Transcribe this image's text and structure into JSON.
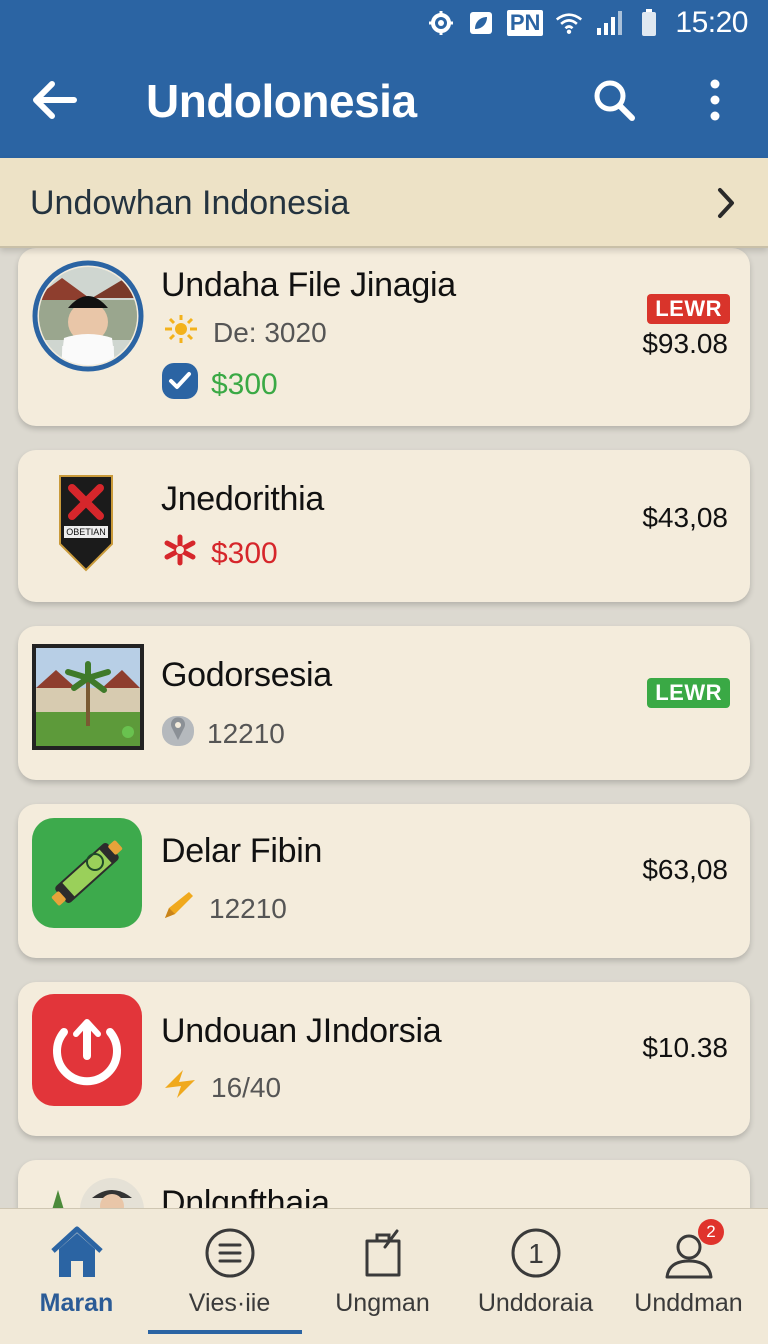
{
  "status_bar": {
    "time": "15:20",
    "carrier": "PN"
  },
  "app_bar": {
    "title": "Undolonesia"
  },
  "category": {
    "label": "Undowhan Indonesia"
  },
  "items": [
    {
      "name": "Undaha File Jinagia",
      "meta_icon": "sun-icon",
      "meta_text": "De: 3020",
      "sub_icon": "check-badge-icon",
      "sub_text": "$300",
      "badge": "LEWR",
      "price": "$93.08"
    },
    {
      "name": "Jnedorithia",
      "logo_text": "OBETIAN",
      "meta_icon": "flower-icon",
      "meta_text": "$300",
      "price": "$43,08"
    },
    {
      "name": "Godorsesia",
      "meta_icon": "pin-icon",
      "meta_text": "12210",
      "badge": "LEWR"
    },
    {
      "name": "Delar Fibin",
      "meta_icon": "pencil-icon",
      "meta_text": "12210",
      "price": "$63,08"
    },
    {
      "name": "Undouan JIndorsia",
      "meta_icon": "bolt-icon",
      "meta_text": "16/40",
      "price": "$10.38"
    },
    {
      "name": "Dnlgnfthaia"
    }
  ],
  "nav": [
    {
      "label": "Maran",
      "icon": "home-icon",
      "active": true
    },
    {
      "label": "Vies·iie",
      "icon": "list-icon"
    },
    {
      "label": "Ungman",
      "icon": "bag-icon"
    },
    {
      "label": "Unddoraia",
      "icon": "one-circle-icon",
      "glyph": "1"
    },
    {
      "label": "Unddman",
      "icon": "profile-icon",
      "badge": "2"
    }
  ],
  "colors": {
    "primary": "#2b64a3",
    "card": "#f4ecdc",
    "accent_red": "#d9342b",
    "accent_green": "#3aa945"
  }
}
